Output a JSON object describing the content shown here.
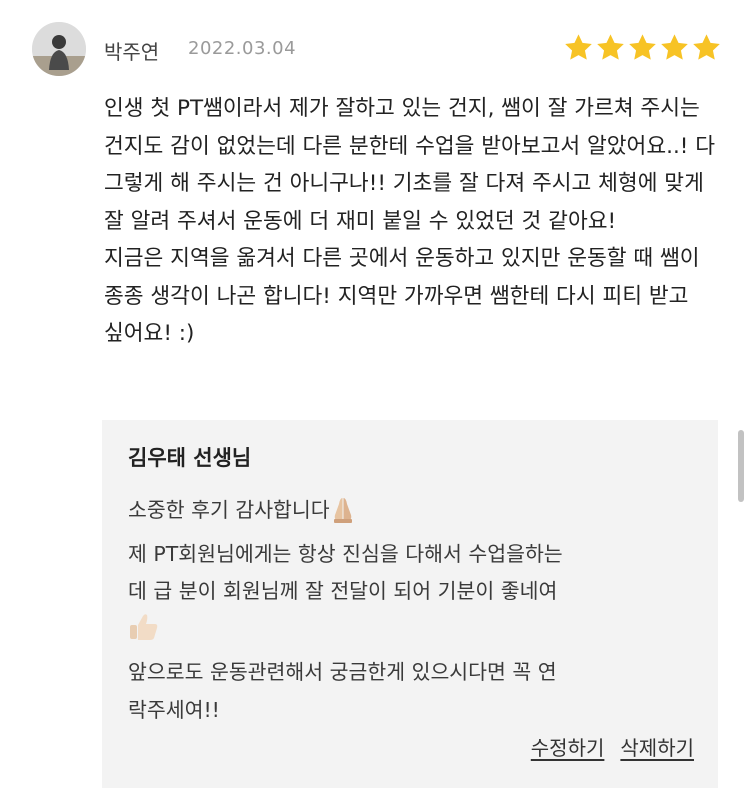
{
  "review": {
    "reviewer_name": "박주연",
    "date": "2022.03.04",
    "rating": 5,
    "rating_max": 5,
    "star_color": "#f7c325",
    "body": "인생 첫 PT쌤이라서 제가 잘하고 있는 건지, 쌤이 잘 가르쳐 주시는 건지도 감이 없었는데 다른 분한테 수업을 받아보고서 알았어요..! 다 그렇게 해 주시는 건 아니구나!! 기초를 잘 다져 주시고 체형에 맞게 잘 알려 주셔서 운동에 더 재미 붙일 수 있었던 것 같아요!\n지금은 지역을 옮겨서 다른 곳에서 운동하고 있지만 운동할 때 쌤이 종종 생각이 나곤 합니다! 지역만 가까우면 쌤한테 다시 피티 받고 싶어요! :)"
  },
  "reply": {
    "author": "김우태 선생님",
    "lines": {
      "l1": "소중한 후기 감사합니다",
      "l2": "제 PT회원님에게는 항상 진심을 다해서 수업을하는",
      "l3": "데 급 분이 회원님께 잘 전달이 되어 기분이 좋네여",
      "l5": "앞으로도 운동관련해서 궁금한게 있으시다면 꼭 연",
      "l6": "락주세여!!"
    },
    "emojis": [
      "folded-hands",
      "thumbs-up"
    ],
    "background": "#f3f3f3"
  },
  "actions": {
    "edit_label": "수정하기",
    "delete_label": "삭제하기"
  }
}
